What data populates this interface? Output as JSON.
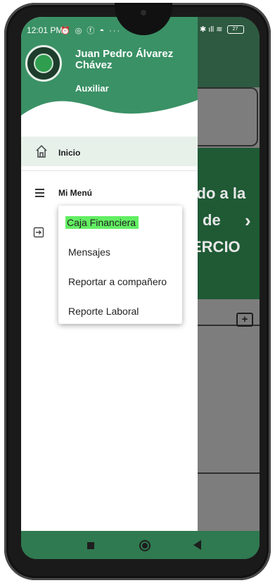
{
  "status_bar": {
    "time": "12:01 PM",
    "left_icons": "⏰ ◎ ⓕ ◓ ···",
    "right_icons": "✱ ıll ≋",
    "battery": "27"
  },
  "drawer": {
    "user_name": "Juan Pedro Álvarez Chávez",
    "user_role": "Auxiliar",
    "nav_inicio": "Inicio",
    "nav_menu": "Mi Menú"
  },
  "popup_menu": {
    "items": [
      {
        "label": "Caja Financiera"
      },
      {
        "label": "Mensajes"
      },
      {
        "label": "Reportar a compañero"
      },
      {
        "label": "Reporte Laboral"
      }
    ]
  },
  "background": {
    "banner_line1": "nido a la",
    "banner_line2": "de",
    "banner_line3": "ERCIO",
    "banner_arrow": "›",
    "message_glyph": "+"
  },
  "colors": {
    "drawer_header": "#3a9165",
    "banner": "#1f5a35",
    "navbar": "#2f7a50",
    "highlight": "#62ee62",
    "inicio_bg": "#e7f1ea"
  }
}
